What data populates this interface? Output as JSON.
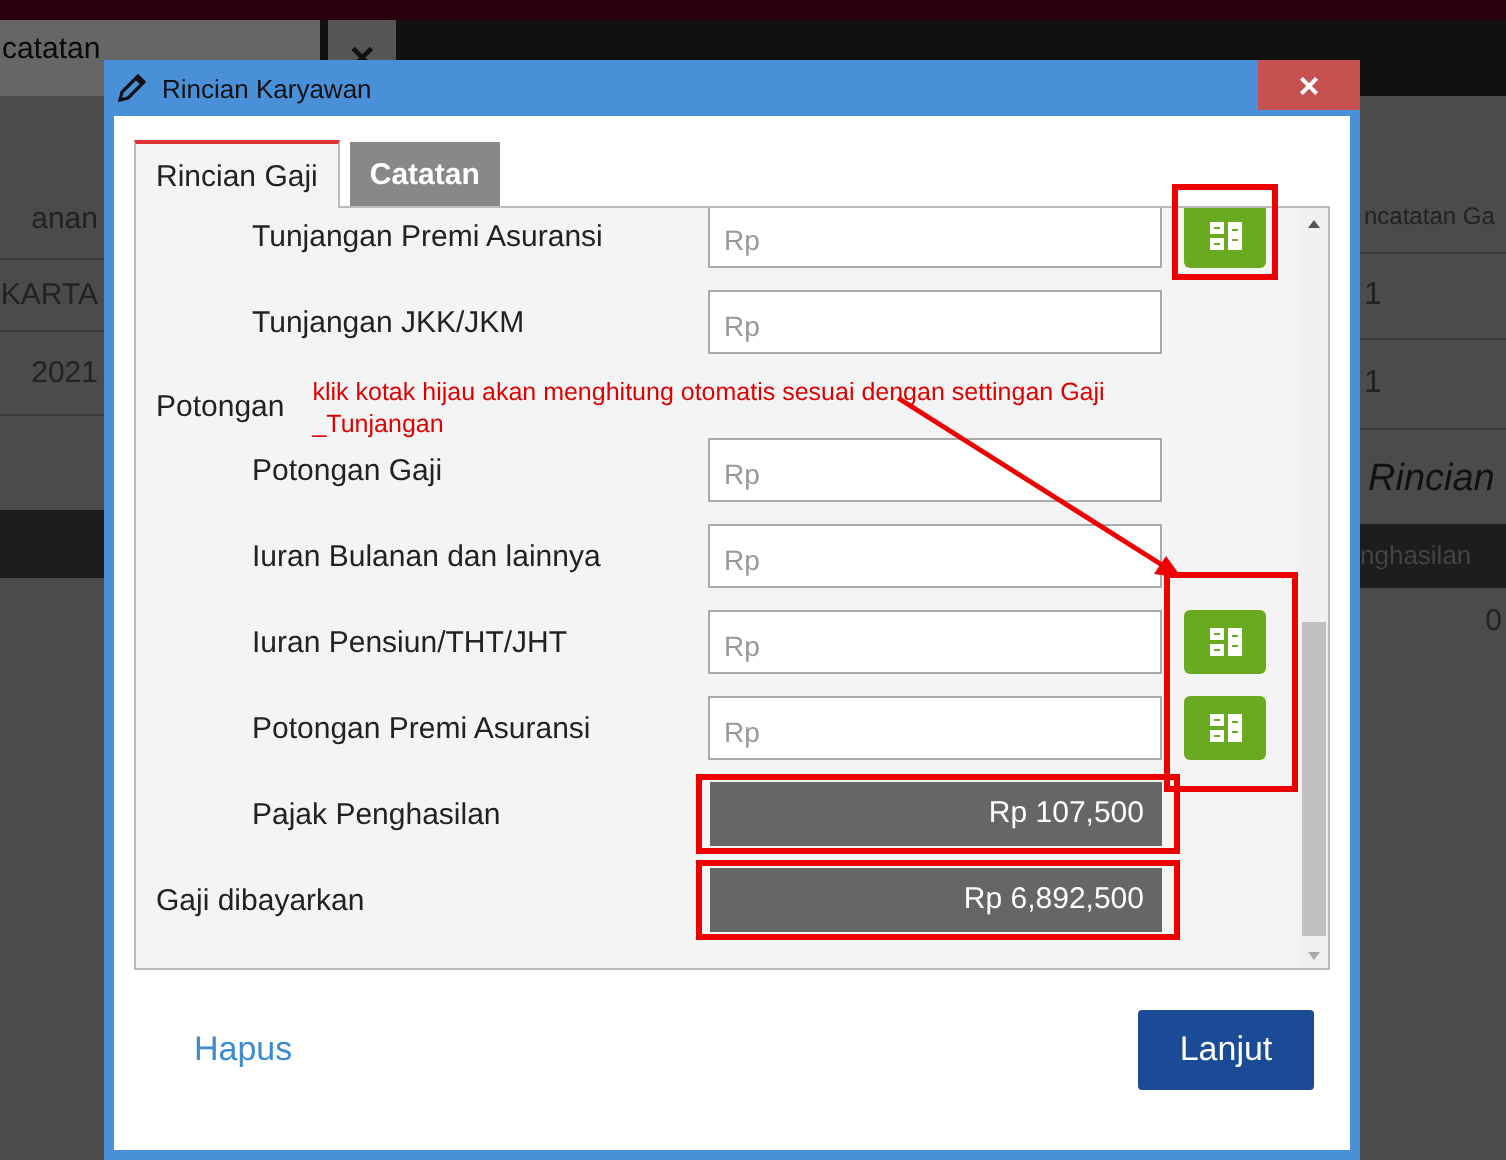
{
  "background": {
    "tab": {
      "label": "catatan",
      "close": "✕"
    },
    "left_cells": [
      "anan",
      "KARTA",
      "2021"
    ],
    "right_cells": [
      "ncatatan Ga",
      "1",
      "1"
    ],
    "right_heading": "Rincian",
    "right_table": {
      "column": "nghasilan",
      "cell": "0"
    }
  },
  "dialog": {
    "title": "Rincian Karyawan",
    "close": "×",
    "tabs": [
      {
        "label": "Rincian Gaji",
        "selected": true
      },
      {
        "label": "Catatan",
        "selected": false
      }
    ],
    "items": [
      {
        "kind": "group",
        "children": [
          {
            "kind": "field",
            "label": "Tunjangan Premi Asuransi",
            "placeholder": "Rp",
            "calc_button": true,
            "highlighted": true
          },
          {
            "kind": "field",
            "label": "Tunjangan JKK/JKM",
            "placeholder": "Rp",
            "calc_button": false
          }
        ]
      },
      {
        "kind": "group",
        "label": "Potongan",
        "note": "klik kotak hijau akan menghitung otomatis sesuai dengan settingan Gaji _Tunjangan",
        "children": [
          {
            "kind": "field",
            "label": "Potongan Gaji",
            "placeholder": "Rp",
            "calc_button": false
          },
          {
            "kind": "field",
            "label": "Iuran Bulanan dan lainnya",
            "placeholder": "Rp",
            "calc_button": false
          },
          {
            "kind": "field",
            "label": "Iuran Pensiun/THT/JHT",
            "placeholder": "Rp",
            "calc_button": true,
            "highlighted": true
          },
          {
            "kind": "field",
            "label": "Potongan Premi Asuransi",
            "placeholder": "Rp",
            "calc_button": true,
            "highlighted": true
          },
          {
            "kind": "total",
            "label": "Pajak Penghasilan",
            "value": "Rp 107,500",
            "highlighted": true
          }
        ]
      },
      {
        "kind": "total",
        "label": "Gaji dibayarkan",
        "value": "Rp 6,892,500",
        "highlighted": true
      }
    ],
    "footer": {
      "delete": "Hapus",
      "next": "Lanjut"
    }
  }
}
